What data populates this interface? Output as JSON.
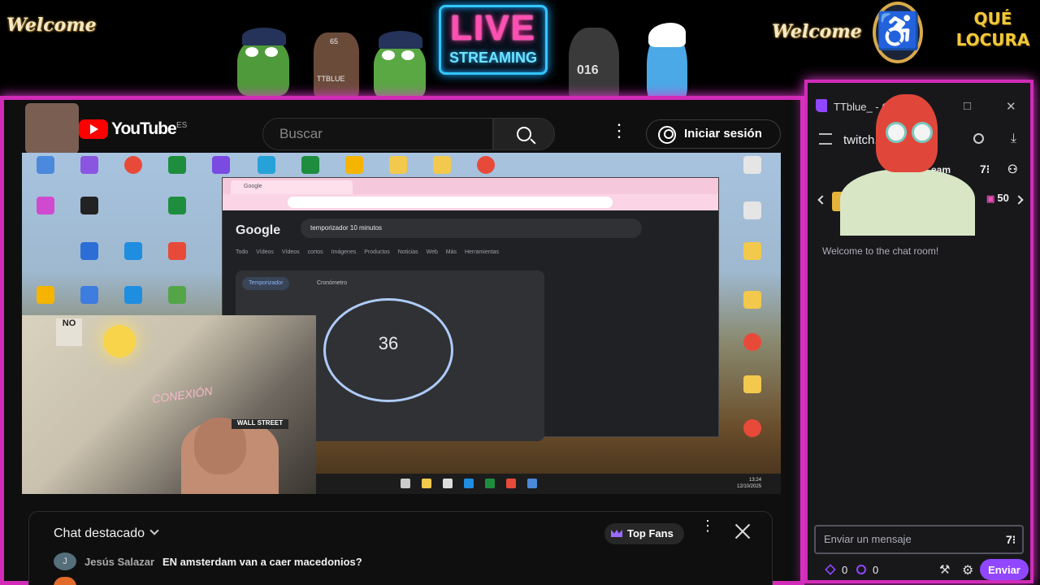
{
  "overlay": {
    "welcome_left": "Welcome",
    "welcome_right": "Welcome",
    "que_locura": "QUÉ LOCURA",
    "live": "LIVE",
    "streaming": "STREAMING",
    "sticker_labels": {
      "brute": "TTBLUE",
      "brute_num": "65",
      "cat_num": "016"
    }
  },
  "youtube": {
    "logo": "YouTube",
    "region": "ES",
    "search_placeholder": "Buscar",
    "signin": "Iniciar sesión",
    "featured_chat": {
      "title": "Chat destacado",
      "top_fans": "Top Fans",
      "messages": [
        {
          "avatar": "J",
          "author": "Jesús Salazar",
          "text": "EN amsterdam van a caer macedonios?"
        }
      ]
    }
  },
  "video": {
    "google_search_text": "temporizador 10 minutos",
    "google_logo": "Google",
    "google_tabs": "Todo Vídeos Vídeos cortos Imágenes Productos Noticias Web Más Herramientas",
    "timer_tab": "Temporizador",
    "stopwatch_tab": "Cronómetro",
    "timer_value": "36",
    "webcam_neon": "CONEXIÓN",
    "webcam_sign": "NO",
    "webcam_poster": "WALL STREET",
    "clock_time": "13:24",
    "clock_date": "12/10/2025"
  },
  "twitch": {
    "window_title": "TTblue_ - C",
    "address": "twitch.t...ut/...",
    "stream_label": "eam",
    "gift_count": "50",
    "welcome_message": "Welcome to the chat room!",
    "input_placeholder": "Enviar un mensaje",
    "points_a": "0",
    "points_b": "0",
    "send": "Enviar"
  },
  "colors": {
    "frame_border": "#d12bb8",
    "twitch_purple": "#9147ff",
    "youtube_red": "#ff0000"
  }
}
